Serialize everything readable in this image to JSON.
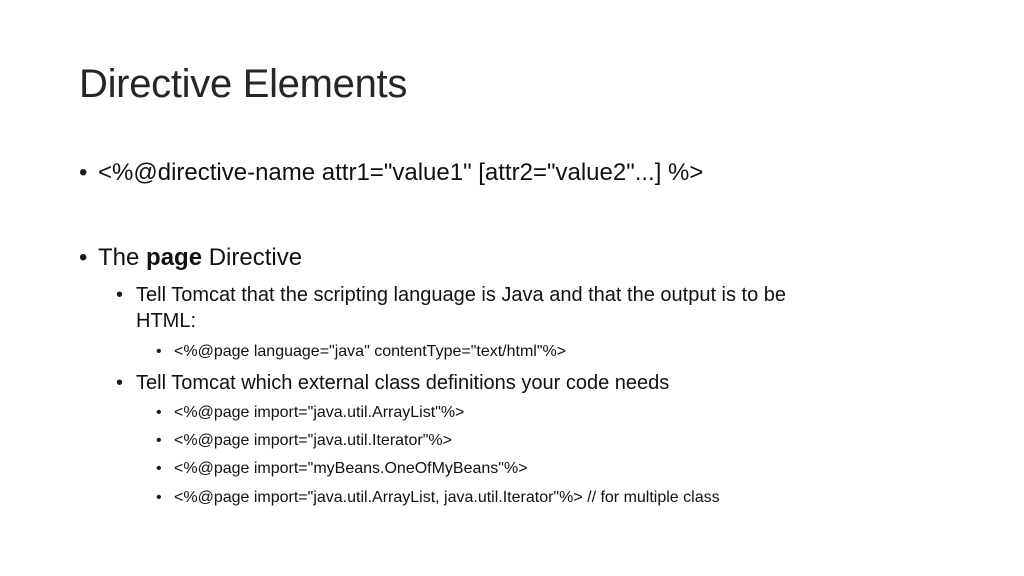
{
  "slide": {
    "title": "Directive Elements",
    "bullet_char": "•",
    "items": [
      {
        "text": "<%@directive-name attr1=\"value1\" [attr2=\"value2\"...] %>"
      },
      {
        "prefix": "The ",
        "bold": "page",
        "suffix": " Directive"
      },
      {
        "line1": "Tell Tomcat that the scripting language is Java and that the output is to be",
        "line2": "HTML:"
      },
      {
        "text": "<%@page language=\"java\" contentType=\"text/html\"%>"
      },
      {
        "text": "Tell Tomcat which external class definitions your code needs"
      },
      {
        "text": "<%@page import=\"java.util.ArrayList\"%>"
      },
      {
        "text": "<%@page import=\"java.util.Iterator\"%>"
      },
      {
        "text": "<%@page import=\"myBeans.OneOfMyBeans\"%>"
      },
      {
        "text": "<%@page import=\"java.util.ArrayList, java.util.Iterator\"%>  // for multiple class"
      }
    ]
  }
}
